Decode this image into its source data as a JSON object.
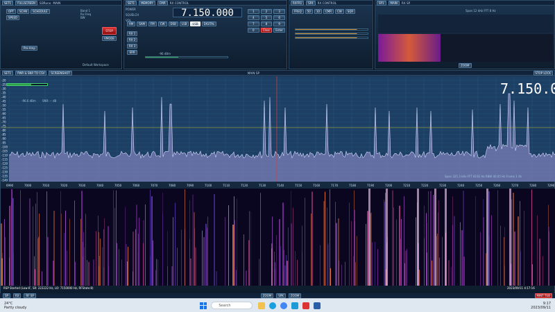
{
  "tabs_top": [
    "SET1",
    "FULLSCREEN",
    "SDRuno",
    "MAIN",
    "RX CONTROL",
    "SP1",
    "MAIN SP"
  ],
  "main": {
    "buttons": [
      "OPT",
      "SCAN",
      "SCHEDULE",
      "SPEED",
      "STOP",
      "VMODE",
      "DEFAULT"
    ],
    "info": [
      "Band 1",
      "Rx Freq",
      "BW",
      "Pre-Amp"
    ],
    "workspace": "Default Workspace"
  },
  "rx": {
    "tabs": [
      "SET1",
      "MEMORY",
      "CMR"
    ],
    "freq": "7.150.000",
    "side_labels": [
      "POWER",
      "SQUELCH",
      "VOL",
      "STEP",
      "AGC",
      "NR",
      "NB",
      "NOTCH"
    ],
    "modes": [
      "AM",
      "SAM",
      "FM",
      "CW",
      "DSB",
      "LSB",
      "USB",
      "DIGITAL"
    ],
    "rows": [
      "RX 1",
      "RX 2",
      "RX 3",
      "ERR",
      "AGC2",
      "BLANK",
      "CLEAR"
    ],
    "dbm": "-96 dBm",
    "keypad": [
      "1",
      "2",
      "3",
      "4",
      "5",
      "6",
      "7",
      "8",
      "9",
      "0",
      "Back",
      "Enter"
    ],
    "clear_btn": "Clear",
    "enter_btn": "Enter"
  },
  "rx2": {
    "tabs": [
      "RXFR1",
      "SP4",
      "SDRuno",
      "RX CONTROL"
    ],
    "items": [
      "FREQ",
      "50",
      "10",
      "CMR",
      "CW",
      "SQR",
      "LSB",
      "USB",
      "AM"
    ]
  },
  "sp": {
    "tabs": [
      "SP1",
      "MAIN",
      "SDRuno",
      "RX SP"
    ],
    "text": "Span 12 kHz  FFT 8 Hz",
    "zoom": "ZOOM"
  },
  "main_sp": {
    "tabs": [
      "SET1",
      "PWR & SNR TO CSV",
      "SCREENSHOT"
    ],
    "title": "MAIN SP",
    "lock": "STOP LOCK",
    "freq": "7.150.000",
    "dbm": "-96.6 dBm",
    "snr": "SNR: -- dB",
    "ylabels": [
      "-20",
      "-25",
      "-30",
      "-35",
      "-40",
      "-45",
      "-50",
      "-55",
      "-60",
      "-65",
      "-70",
      "-75",
      "-80",
      "-85",
      "-90",
      "-95",
      "-100",
      "-105",
      "-110",
      "-115",
      "-120",
      "-125",
      "-130",
      "-135",
      "-140"
    ],
    "xlabels": [
      "6990",
      "7000",
      "7010",
      "7020",
      "7030",
      "7040",
      "7050",
      "7060",
      "7070",
      "7080",
      "7090",
      "7100",
      "7110",
      "7120",
      "7130",
      "7140",
      "7150",
      "7160",
      "7170",
      "7180",
      "7190",
      "7200",
      "7210",
      "7220",
      "7230",
      "7240",
      "7250",
      "7260",
      "7270",
      "7280",
      "7290"
    ],
    "status": "Span 325.3 kHz  FFT 8192 Hz  RBW 40.05 Hz  Frame 1 4k",
    "footer": "RSP Started (Low-IF, SR: 222222 Hz, LO: 7150000 Hz, RFState:8)",
    "timestamp": "2023/09/11 4:17:16",
    "bottom_btns": [
      "SP",
      "RX",
      "RF SP",
      "ZOOM",
      "SPK",
      "ZOOM",
      "MINT TUB"
    ]
  },
  "taskbar": {
    "weather": "24°C",
    "weather_sub": "Partly cloudy",
    "search": "Search",
    "time": "9:17",
    "date": "2023/09/11"
  }
}
